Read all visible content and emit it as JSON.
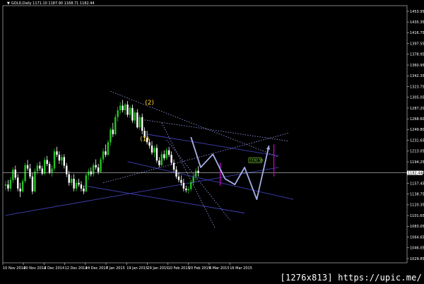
{
  "window": {
    "symbol_arrow": "▼",
    "symbol_header": "GOLD,Daily  1171.10 1187.90 1168.71 1182.44"
  },
  "watermark": "[1276x813] https://upic.me/",
  "colors": {
    "background": "#000000",
    "bull_candle": "#22c322",
    "bear_candle": "#ffffff",
    "trendline": "#3f40b4",
    "channel_dotted": "#8a8fd8",
    "projection_path": "#a6b0e8",
    "wave_label": "#ffd21e",
    "magenta_marker": "#c000c0",
    "price_line": "#d0d0d0",
    "price_tag_border": "#9aff46"
  },
  "chart_data": {
    "type": "candlestick",
    "instrument": "GOLD",
    "timeframe": "Daily",
    "header_ohlc": {
      "open": 1171.1,
      "high": 1187.9,
      "low": 1168.71,
      "close": 1182.44
    },
    "current_price": 1182.44,
    "price_tag": "1182.44",
    "marker_tag": "1192.53",
    "ylim": [
      1025,
      1475
    ],
    "y_ticks": [
      "1453.95",
      "1435.35",
      "1416.75",
      "1397.55",
      "1378.95",
      "1360.95",
      "1342.35",
      "1323.75",
      "1305.05",
      "1287.20",
      "1268.60",
      "1249.80",
      "1231.65",
      "1213.05",
      "1194.25",
      "1176.05",
      "1157.45",
      "1138.75",
      "1120.35",
      "1101.65",
      "1083.05",
      "1064.65",
      "1046.05",
      "1029.85"
    ],
    "x_ticks": [
      "10 Nov 2014",
      "20 Nov 2014",
      "2 Dec 2014",
      "12 Dec 2014",
      "24 Dec 2014",
      "7 Jan 2015",
      "19 Jan 2015",
      "29 Jan 2015",
      "10 Feb 2015",
      "20 Feb 2015",
      "4 Mar 2015",
      "16 Mar 2015"
    ],
    "wave_labels": [
      {
        "text": "(2)",
        "at_bar": 56,
        "price": 1302
      },
      {
        "text": "(1)",
        "at_bar": 54,
        "price": 1238
      }
    ],
    "candles": [
      [
        1160,
        1168,
        1152,
        1162
      ],
      [
        1162,
        1170,
        1150,
        1155
      ],
      [
        1155,
        1175,
        1150,
        1170
      ],
      [
        1170,
        1192,
        1165,
        1188
      ],
      [
        1188,
        1195,
        1170,
        1174
      ],
      [
        1174,
        1180,
        1150,
        1155
      ],
      [
        1155,
        1165,
        1140,
        1150
      ],
      [
        1150,
        1172,
        1148,
        1168
      ],
      [
        1168,
        1200,
        1165,
        1196
      ],
      [
        1196,
        1205,
        1186,
        1190
      ],
      [
        1190,
        1198,
        1172,
        1176
      ],
      [
        1176,
        1182,
        1145,
        1150
      ],
      [
        1150,
        1190,
        1148,
        1185
      ],
      [
        1185,
        1200,
        1180,
        1195
      ],
      [
        1195,
        1202,
        1186,
        1190
      ],
      [
        1190,
        1195,
        1178,
        1181
      ],
      [
        1181,
        1210,
        1178,
        1205
      ],
      [
        1205,
        1212,
        1194,
        1198
      ],
      [
        1198,
        1202,
        1180,
        1183
      ],
      [
        1183,
        1196,
        1176,
        1190
      ],
      [
        1190,
        1225,
        1186,
        1220
      ],
      [
        1220,
        1228,
        1210,
        1214
      ],
      [
        1214,
        1220,
        1198,
        1204
      ],
      [
        1204,
        1215,
        1196,
        1210
      ],
      [
        1210,
        1215,
        1190,
        1195
      ],
      [
        1195,
        1200,
        1175,
        1180
      ],
      [
        1180,
        1186,
        1160,
        1165
      ],
      [
        1165,
        1178,
        1160,
        1172
      ],
      [
        1172,
        1180,
        1150,
        1155
      ],
      [
        1155,
        1170,
        1150,
        1165
      ],
      [
        1165,
        1172,
        1158,
        1162
      ],
      [
        1162,
        1168,
        1150,
        1155
      ],
      [
        1155,
        1160,
        1145,
        1150
      ],
      [
        1150,
        1182,
        1148,
        1178
      ],
      [
        1178,
        1190,
        1170,
        1185
      ],
      [
        1185,
        1192,
        1176,
        1180
      ],
      [
        1180,
        1200,
        1176,
        1196
      ],
      [
        1196,
        1206,
        1188,
        1192
      ],
      [
        1192,
        1198,
        1180,
        1184
      ],
      [
        1184,
        1210,
        1182,
        1206
      ],
      [
        1206,
        1225,
        1200,
        1220
      ],
      [
        1220,
        1232,
        1210,
        1214
      ],
      [
        1214,
        1240,
        1212,
        1236
      ],
      [
        1236,
        1262,
        1230,
        1258
      ],
      [
        1258,
        1270,
        1245,
        1250
      ],
      [
        1250,
        1285,
        1248,
        1280
      ],
      [
        1280,
        1298,
        1272,
        1292
      ],
      [
        1292,
        1306,
        1286,
        1300
      ],
      [
        1300,
        1310,
        1288,
        1292
      ],
      [
        1292,
        1305,
        1284,
        1302
      ],
      [
        1302,
        1308,
        1280,
        1284
      ],
      [
        1284,
        1300,
        1278,
        1296
      ],
      [
        1296,
        1302,
        1270,
        1274
      ],
      [
        1274,
        1292,
        1268,
        1288
      ],
      [
        1288,
        1294,
        1260,
        1262
      ],
      [
        1262,
        1284,
        1258,
        1280
      ],
      [
        1280,
        1286,
        1250,
        1256
      ],
      [
        1256,
        1262,
        1238,
        1244
      ],
      [
        1244,
        1256,
        1232,
        1236
      ],
      [
        1236,
        1242,
        1225,
        1230
      ],
      [
        1230,
        1238,
        1214,
        1218
      ],
      [
        1218,
        1230,
        1210,
        1226
      ],
      [
        1226,
        1232,
        1200,
        1204
      ],
      [
        1204,
        1210,
        1192,
        1196
      ],
      [
        1196,
        1220,
        1194,
        1215
      ],
      [
        1215,
        1222,
        1204,
        1208
      ],
      [
        1208,
        1226,
        1205,
        1222
      ],
      [
        1222,
        1228,
        1210,
        1214
      ],
      [
        1214,
        1220,
        1196,
        1200
      ],
      [
        1200,
        1206,
        1184,
        1188
      ],
      [
        1188,
        1194,
        1172,
        1176
      ],
      [
        1176,
        1184,
        1166,
        1170
      ],
      [
        1170,
        1178,
        1160,
        1165
      ],
      [
        1165,
        1172,
        1150,
        1155
      ],
      [
        1155,
        1160,
        1148,
        1152
      ],
      [
        1152,
        1158,
        1146,
        1154
      ],
      [
        1154,
        1170,
        1150,
        1166
      ],
      [
        1166,
        1180,
        1160,
        1176
      ],
      [
        1176,
        1190,
        1170,
        1186
      ],
      [
        1186,
        1194,
        1176,
        1182
      ]
    ],
    "trendlines": [
      {
        "style": "solid",
        "from": [
          0,
          1108
        ],
        "to": [
          112,
          1192
        ]
      },
      {
        "style": "solid",
        "from": [
          32,
          1160
        ],
        "to": [
          98,
          1112
        ]
      },
      {
        "style": "solid",
        "from": [
          50,
          1202
        ],
        "to": [
          118,
          1136
        ]
      },
      {
        "style": "solid",
        "from": [
          58,
          1250
        ],
        "to": [
          112,
          1212
        ]
      },
      {
        "style": "dotted",
        "from": [
          43,
          1325
        ],
        "to": [
          112,
          1210
        ]
      },
      {
        "style": "dotted",
        "from": [
          57,
          1275
        ],
        "to": [
          116,
          1238
        ]
      },
      {
        "style": "dotted",
        "from": [
          40,
          1165
        ],
        "to": [
          116,
          1252
        ]
      },
      {
        "style": "dotted",
        "from": [
          64,
          1270
        ],
        "to": [
          86,
          1085
        ]
      },
      {
        "style": "dotted",
        "from": [
          66,
          1240
        ],
        "to": [
          92,
          1100
        ]
      }
    ],
    "projection_path": [
      {
        "bar": 76,
        "price": 1245
      },
      {
        "bar": 80,
        "price": 1192
      },
      {
        "bar": 85,
        "price": 1215
      },
      {
        "bar": 90,
        "price": 1172
      },
      {
        "bar": 94,
        "price": 1162
      },
      {
        "bar": 98,
        "price": 1192
      },
      {
        "bar": 103,
        "price": 1136
      },
      {
        "bar": 108,
        "price": 1230
      }
    ],
    "magenta_markers": [
      {
        "bar": 88,
        "from": 1160,
        "to": 1200
      },
      {
        "bar": 110,
        "from": 1176,
        "to": 1232
      }
    ],
    "ohlc_order": "open,high,low,close"
  }
}
